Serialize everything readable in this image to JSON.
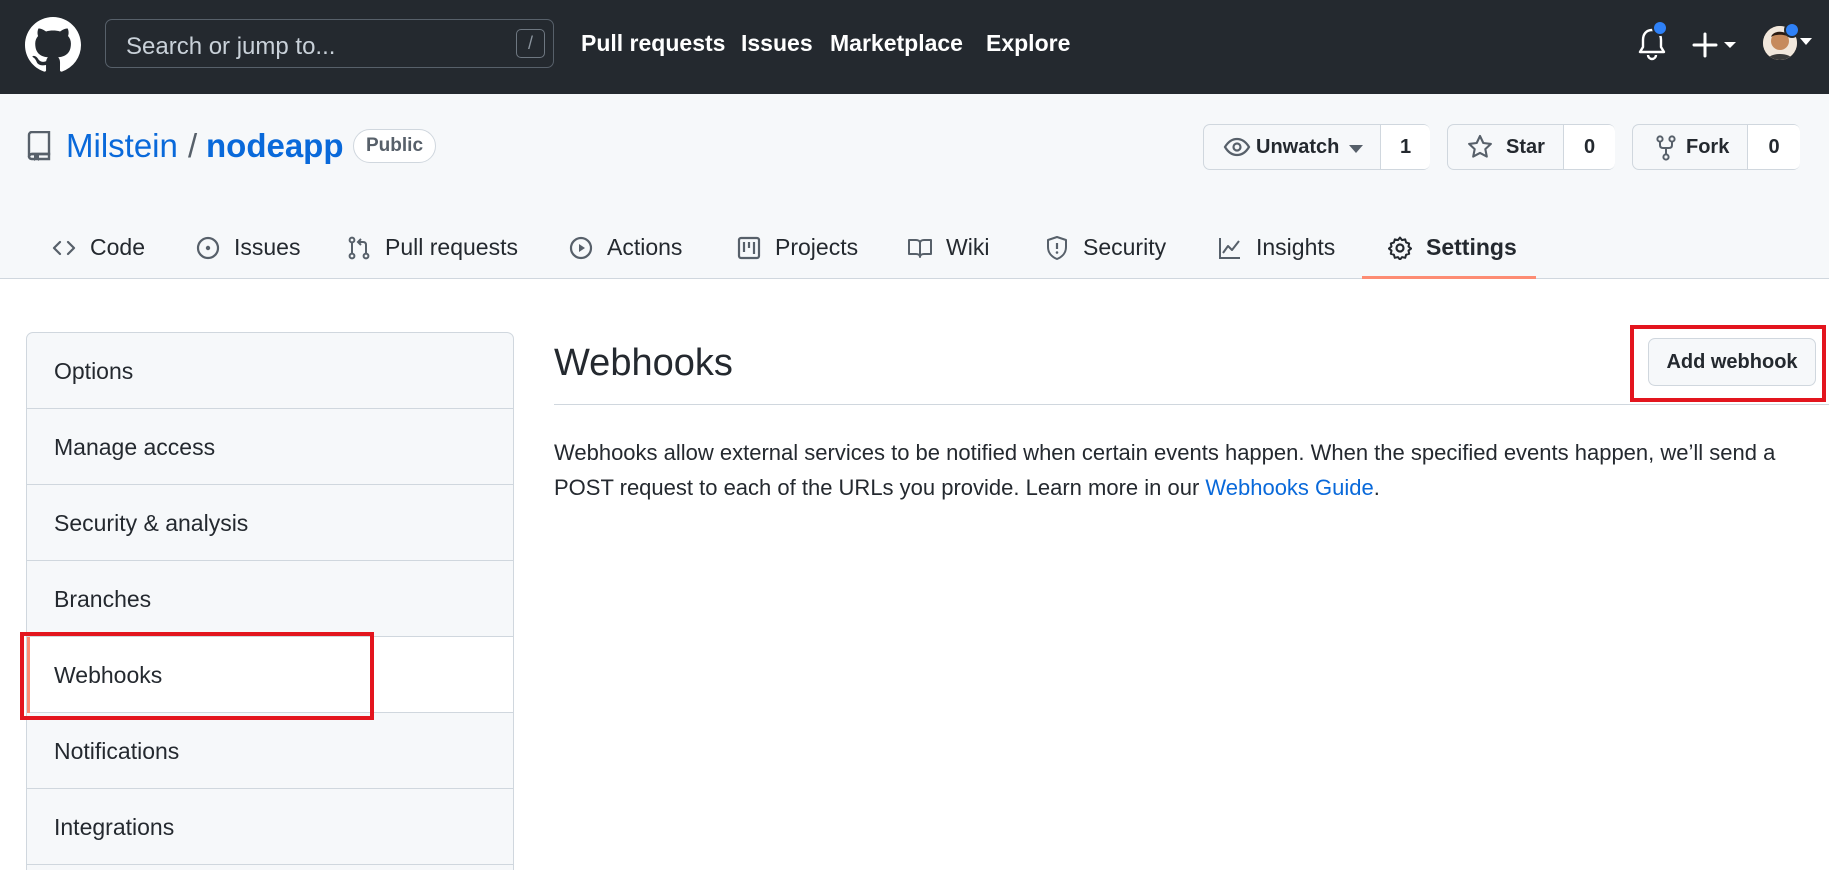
{
  "topbar": {
    "search_placeholder": "Search or jump to...",
    "search_shortcut": "/",
    "nav": [
      "Pull requests",
      "Issues",
      "Marketplace",
      "Explore"
    ]
  },
  "repo": {
    "owner": "Milstein",
    "separator": "/",
    "name": "nodeapp",
    "visibility": "Public",
    "watch_label": "Unwatch",
    "watch_count": "1",
    "star_label": "Star",
    "star_count": "0",
    "fork_label": "Fork",
    "fork_count": "0"
  },
  "tabs": [
    {
      "label": "Code",
      "icon": "code-icon"
    },
    {
      "label": "Issues",
      "icon": "issue-icon"
    },
    {
      "label": "Pull requests",
      "icon": "pull-request-icon"
    },
    {
      "label": "Actions",
      "icon": "play-icon"
    },
    {
      "label": "Projects",
      "icon": "project-icon"
    },
    {
      "label": "Wiki",
      "icon": "book-icon"
    },
    {
      "label": "Security",
      "icon": "shield-icon"
    },
    {
      "label": "Insights",
      "icon": "graph-icon"
    },
    {
      "label": "Settings",
      "icon": "gear-icon",
      "active": true
    }
  ],
  "sidebar": {
    "items": [
      "Options",
      "Manage access",
      "Security & analysis",
      "Branches",
      "Webhooks",
      "Notifications",
      "Integrations"
    ],
    "selected": "Webhooks"
  },
  "main": {
    "title": "Webhooks",
    "add_button": "Add webhook",
    "description_before_link": "Webhooks allow external services to be notified when certain events happen. When the specified events happen, we’ll send a POST request to each of the URLs you provide. Learn more in our ",
    "link_text": "Webhooks Guide",
    "description_after_link": "."
  },
  "colors": {
    "header_bg": "#24292f",
    "link": "#0969da",
    "active_tab_underline": "#fd8c73",
    "highlight_box": "#e3151e"
  }
}
